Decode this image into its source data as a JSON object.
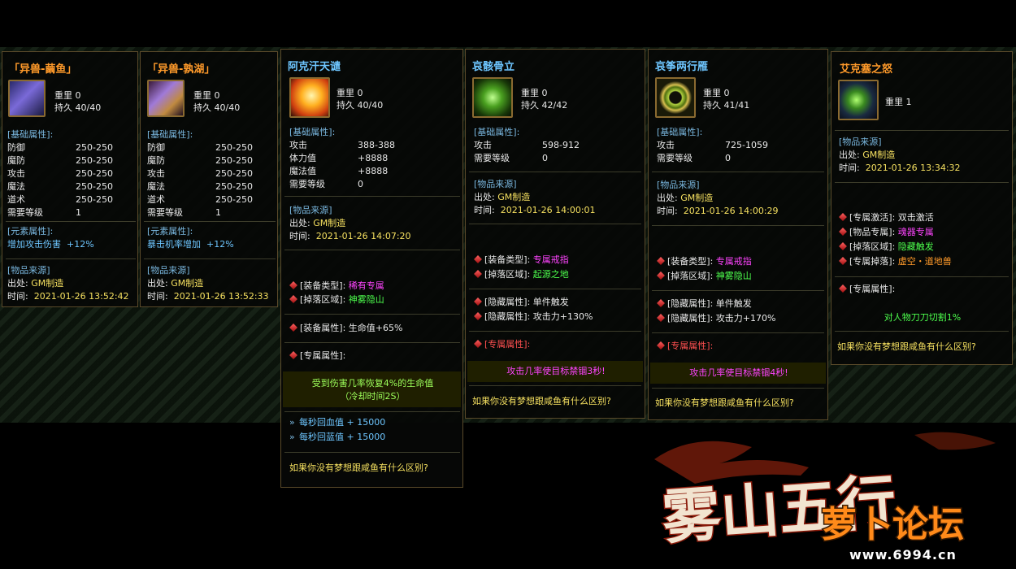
{
  "p1": {
    "title": "「异兽-繭鱼」",
    "weight": "重里  0",
    "durability": "持久  40/40",
    "base_header": "[基础属性]:",
    "stats": [
      [
        "防御",
        "250-250"
      ],
      [
        "魔防",
        "250-250"
      ],
      [
        "攻击",
        "250-250"
      ],
      [
        "魔法",
        "250-250"
      ],
      [
        "道术",
        "250-250"
      ],
      [
        "需要等级",
        "1"
      ]
    ],
    "elem_header": "[元素属性]:",
    "elem_name": "增加攻击伤害",
    "elem_val": "+12%",
    "src_header": "[物品来源]",
    "origin_label": "出处:",
    "origin_val": "GM制造",
    "time_label": "时间:",
    "time_val": "2021-01-26 13:52:42"
  },
  "p2": {
    "title": "「异兽-孰湖」",
    "weight": "重里  0",
    "durability": "持久  40/40",
    "base_header": "[基础属性]:",
    "stats": [
      [
        "防御",
        "250-250"
      ],
      [
        "魔防",
        "250-250"
      ],
      [
        "攻击",
        "250-250"
      ],
      [
        "魔法",
        "250-250"
      ],
      [
        "道术",
        "250-250"
      ],
      [
        "需要等级",
        "1"
      ]
    ],
    "elem_header": "[元素属性]:",
    "elem_name": "暴击机率增加",
    "elem_val": "+12%",
    "src_header": "[物品来源]",
    "origin_label": "出处:",
    "origin_val": "GM制造",
    "time_label": "时间:",
    "time_val": "2021-01-26 13:52:33"
  },
  "p3": {
    "title": "阿克汗天谴",
    "weight": "重里  0",
    "durability": "持久  40/40",
    "base_header": "[基础属性]:",
    "stats": [
      [
        "攻击",
        "388-388"
      ],
      [
        "体力值",
        "+8888"
      ],
      [
        "魔法值",
        "+8888"
      ],
      [
        "需要等级",
        "0"
      ]
    ],
    "src_header": "[物品来源]",
    "origin_label": "出处:",
    "origin_val": "GM制造",
    "time_label": "时间:",
    "time_val": "2021-01-26 14:07:20",
    "type_label": "[装备类型]:",
    "type_val": "稀有专属",
    "drop_label": "[掉落区域]:",
    "drop_val": "神雾隐山",
    "equip_label": "[装备属性]:",
    "equip_val": "生命值+65%",
    "excl_label": "[专属属性]:",
    "excl_line1": "受到伤害几率恢复4%的生命值",
    "excl_line2": "（冷却时间2S）",
    "regen1": "每秒回血值  + 15000",
    "regen2": "每秒回蓝值  + 15000",
    "footer": "如果你没有梦想跟咸鱼有什么区别?"
  },
  "p4": {
    "title": "哀骸骨立",
    "weight": "重里  0",
    "durability": "持久  42/42",
    "base_header": "[基础属性]:",
    "stats": [
      [
        "攻击",
        "598-912"
      ],
      [
        "需要等级",
        "0"
      ]
    ],
    "src_header": "[物品来源]",
    "origin_label": "出处:",
    "origin_val": "GM制造",
    "time_label": "时间:",
    "time_val": "2021-01-26 14:00:01",
    "type_label": "[装备类型]:",
    "type_val": "专属戒指",
    "drop_label": "[掉落区域]:",
    "drop_val": "起源之地",
    "hidden1_label": "[隐藏属性]:",
    "hidden1_val": "单件触发",
    "hidden2_label": "[隐藏属性]:",
    "hidden2_val": "攻击力+130%",
    "excl_label": "[专属属性]:",
    "excl_text": "攻击几率使目标禁锢3秒!",
    "footer": "如果你没有梦想跟咸鱼有什么区别?"
  },
  "p5": {
    "title": "哀筝两行雁",
    "weight": "重里  0",
    "durability": "持久  41/41",
    "base_header": "[基础属性]:",
    "stats": [
      [
        "攻击",
        "725-1059"
      ],
      [
        "需要等级",
        "0"
      ]
    ],
    "src_header": "[物品来源]",
    "origin_label": "出处:",
    "origin_val": "GM制造",
    "time_label": "时间:",
    "time_val": "2021-01-26 14:00:29",
    "type_label": "[装备类型]:",
    "type_val": "专属戒指",
    "drop_label": "[掉落区域]:",
    "drop_val": "神雾隐山",
    "hidden1_label": "[隐藏属性]:",
    "hidden1_val": "单件触发",
    "hidden2_label": "[隐藏属性]:",
    "hidden2_val": "攻击力+170%",
    "excl_label": "[专属属性]:",
    "excl_text": "攻击几率使目标禁锢4秒!",
    "footer": "如果你没有梦想跟咸鱼有什么区别?"
  },
  "p6": {
    "title": "艾克塞之怒",
    "weight": "重里  1",
    "src_header": "[物品来源]",
    "origin_label": "出处:",
    "origin_val": "GM制造",
    "time_label": "时间:",
    "time_val": "2021-01-26 13:34:32",
    "activate_label": "[专属激活]:",
    "activate_val": "双击激活",
    "item_excl_label": "[物品专属]:",
    "item_excl_val": "魂器专属",
    "drop_label": "[掉落区域]:",
    "drop_val": "隐藏触发",
    "excl_drop_label": "[专属掉落]:",
    "excl_drop_val": "虚空・道地兽",
    "excl_label": "[专属属性]:",
    "excl_text": "对人物刀刀切割1%",
    "footer": "如果你没有梦想跟咸鱼有什么区别?"
  },
  "logo": {
    "game_name": "雾山五行",
    "forum_name": "萝卜论坛",
    "site": "www.6994.cn"
  },
  "colors": {
    "title_orange": "#ff9a2a",
    "title_cyan": "#6ec6ff",
    "title_yellow": "#f5e060",
    "header_blue": "#7ab8e0",
    "magenta": "#ff44ff",
    "green": "#4dff4d"
  }
}
